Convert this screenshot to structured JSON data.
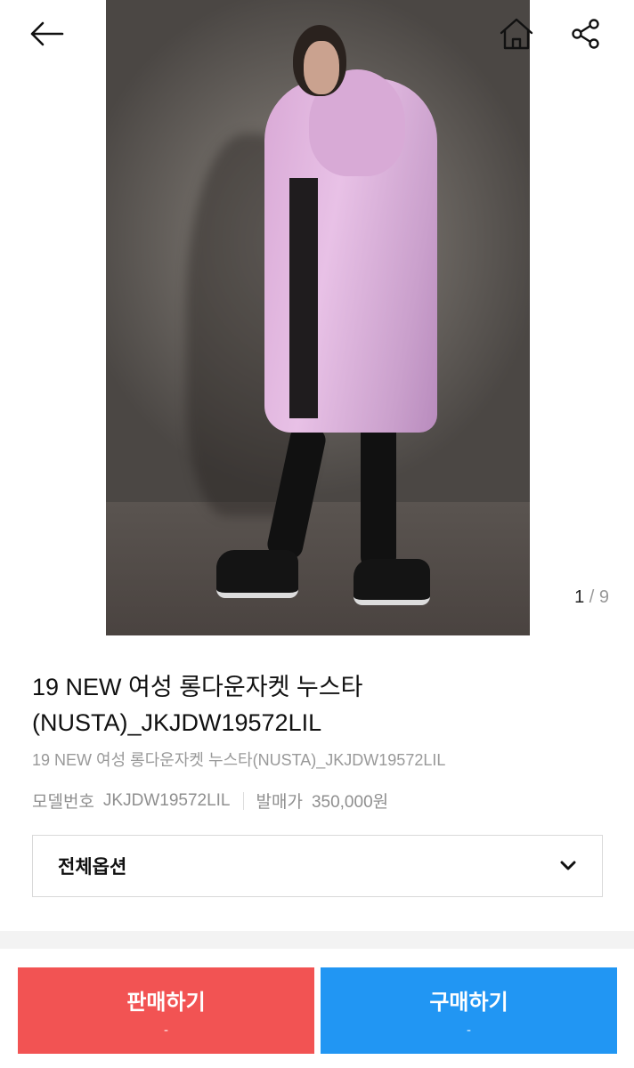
{
  "gallery": {
    "current": "1",
    "separator": "/",
    "total": "9"
  },
  "product": {
    "title": "19 NEW 여성 롱다운자켓 누스타(NUSTA)_JKJDW19572LIL",
    "subtitle": "19 NEW 여성 롱다운자켓 누스타(NUSTA)_JKJDW19572LIL",
    "model_label": "모델번호",
    "model_value": "JKJDW19572LIL",
    "price_label": "발매가",
    "price_value": "350,000원"
  },
  "options": {
    "label": "전체옵션"
  },
  "actions": {
    "sell_label": "판매하기",
    "sell_sub": "-",
    "buy_label": "구매하기",
    "buy_sub": "-"
  },
  "colors": {
    "sell": "#f25353",
    "buy": "#2196f3"
  },
  "icons": [
    "back-arrow-icon",
    "home-icon",
    "share-icon",
    "chevron-down-icon"
  ]
}
